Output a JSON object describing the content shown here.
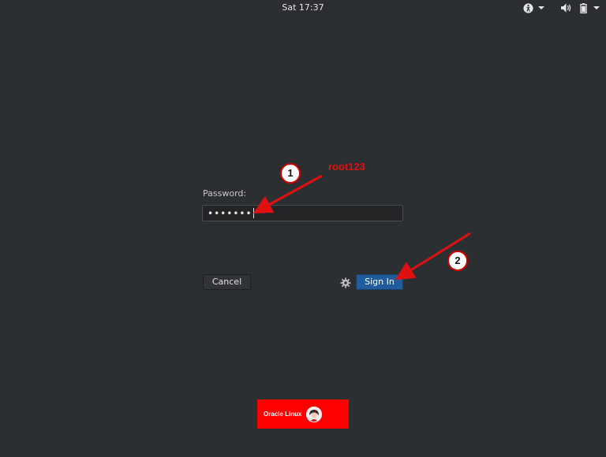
{
  "topbar": {
    "clock": "Sat 17:37",
    "icons": [
      "accessibility-icon",
      "chevron-down-icon",
      "volume-icon",
      "battery-icon",
      "chevron-down-icon"
    ]
  },
  "login": {
    "password_label": "Password:",
    "password_value": "•••••••",
    "cancel_label": "Cancel",
    "signin_label": "Sign In",
    "settings_icon": "gear-icon"
  },
  "annotations": {
    "step1": "1",
    "step2": "2",
    "password_hint": "root123",
    "color": "#e01010"
  },
  "banner": {
    "text": "Oracle Linux",
    "background": "#ff0000"
  },
  "colors": {
    "background": "#2c2f31",
    "accent": "#215d9c"
  }
}
